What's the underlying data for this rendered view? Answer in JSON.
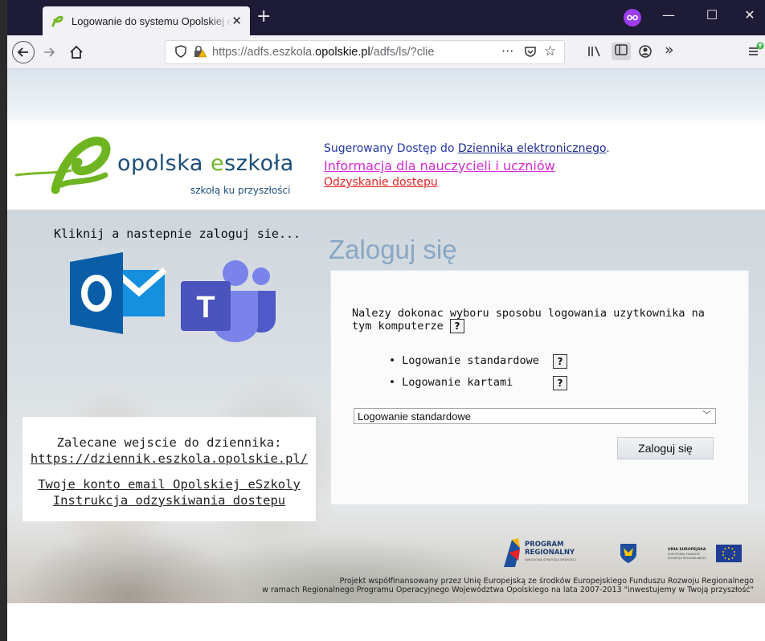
{
  "browser": {
    "tab_title": "Logowanie do systemu Opolskiej eSzkoły",
    "new_tab": "+",
    "url_prefix": "https://adfs.eszkola.",
    "url_domain": "opolskie.pl",
    "url_suffix": "/adfs/ls/?clie",
    "more": "···",
    "overflow": "»",
    "colors": {
      "titlebar": "#1e1b36",
      "private": "#9b3cf0"
    }
  },
  "logo": {
    "word_part1": "opolska ",
    "word_green": "e",
    "word_part2": "szkoła",
    "tagline": "szkołą ku przyszłości"
  },
  "toplinks": {
    "suggested_prefix": "Sugerowany Dostęp do ",
    "suggested_link": "Dziennika elektronicznego",
    "suggested_suffix": ".",
    "info": "Informacja dla nauczycieli i uczniów",
    "recovery": "Odzyskanie dostepu"
  },
  "left": {
    "click_text": "Kliknij a nastepnie zaloguj sie...",
    "outlook_letter": "O",
    "teams_letter": "T",
    "recommended": "Zalecane wejscie do dziennika:",
    "diary_link": "https://dziennik.eszkola.opolskie.pl/",
    "email_link": "Twoje konto email Opolskiej eSzkoly",
    "recovery_link": "Instrukcja odzyskiwania dostepu"
  },
  "login": {
    "title": "Zaloguj się",
    "message": "Nalezy dokonac wyboru sposobu logowania uzytkownika na tym komputerze",
    "help": "?",
    "methods": [
      "Logowanie standardowe",
      "Logowanie kartami"
    ],
    "selected": "Logowanie standardowe",
    "button": "Zaloguj się"
  },
  "footer": {
    "program_line1": "PROGRAM",
    "program_line2": "REGIONALNY",
    "program_line3": "NARODOWA STRATEGIA SPÓJNOŚCI",
    "eu_line1": "UNIA EUROPEJSKA",
    "eu_line2": "EUROPEJSKI FUNDUSZ",
    "eu_line3": "ROZWOJU REGIONALNEGO",
    "line1": "Projekt współfinansowany przez Unię Europejską ze środków Europejskiego Funduszu Rozwoju Regionalnego",
    "line2": "w ramach Regionalnego Programu Operacyjnego Województwa Opolskiego na lata 2007-2013 \"inwestujemy w Twoją przyszłość\""
  }
}
